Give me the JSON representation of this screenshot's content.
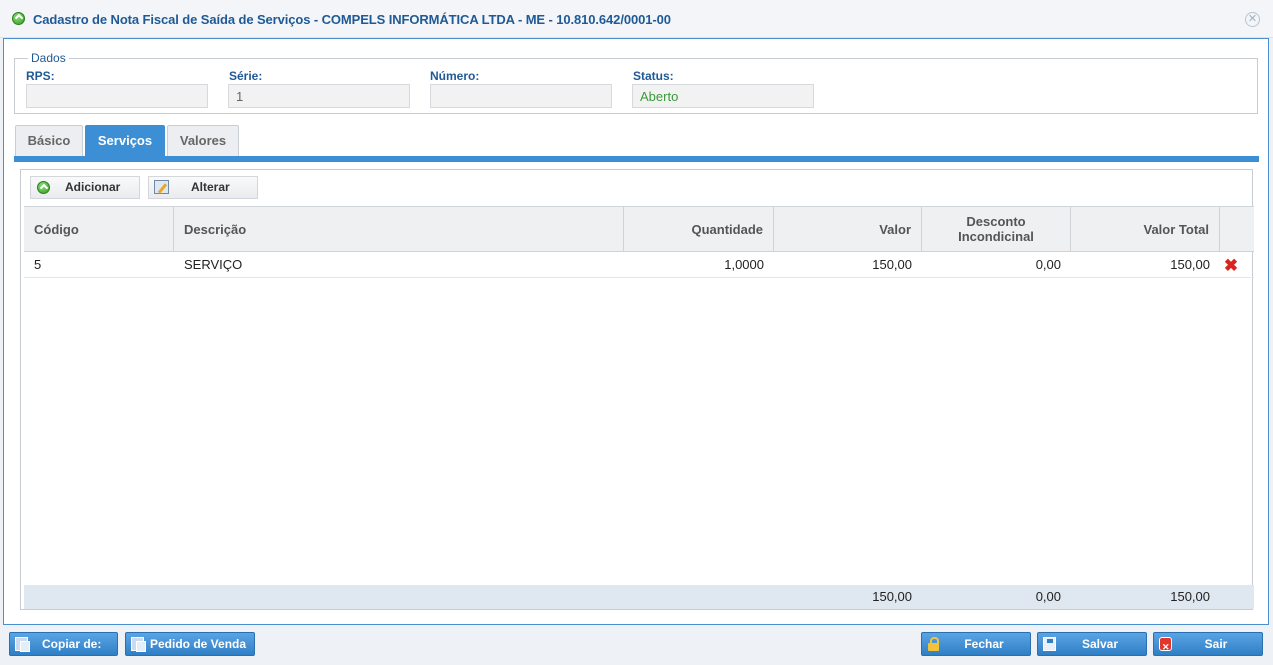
{
  "window": {
    "title": "Cadastro de Nota Fiscal de Saída de Serviços - COMPELS INFORMÁTICA LTDA - ME - 10.810.642/0001-00"
  },
  "dados": {
    "legend": "Dados",
    "fields": {
      "rps": {
        "label": "RPS:",
        "value": ""
      },
      "serie": {
        "label": "Série:",
        "value": "1"
      },
      "numero": {
        "label": "Número:",
        "value": ""
      },
      "status": {
        "label": "Status:",
        "value": "Aberto"
      }
    }
  },
  "tabs": [
    "Básico",
    "Serviços",
    "Valores"
  ],
  "active_tab": "Serviços",
  "toolbar": {
    "add_label": "Adicionar",
    "edit_label": "Alterar"
  },
  "grid": {
    "columns": [
      "Código",
      "Descrição",
      "Quantidade",
      "Valor",
      "Desconto Incondicinal",
      "Valor Total"
    ],
    "rows": [
      {
        "codigo": "5",
        "descricao": "SERVIÇO",
        "quantidade": "1,0000",
        "valor": "150,00",
        "desconto": "0,00",
        "valor_total": "150,00"
      }
    ],
    "totals": {
      "valor": "150,00",
      "desconto": "0,00",
      "valor_total": "150,00"
    }
  },
  "footer": {
    "copy_label": "Copiar de:",
    "order_label": "Pedido de Venda",
    "close_label": "Fechar",
    "save_label": "Salvar",
    "exit_label": "Sair"
  },
  "colors": {
    "accent": "#3d8fd5",
    "title": "#1f5a96",
    "status_green": "#3a9a3a",
    "delete_red": "#d8251f"
  }
}
